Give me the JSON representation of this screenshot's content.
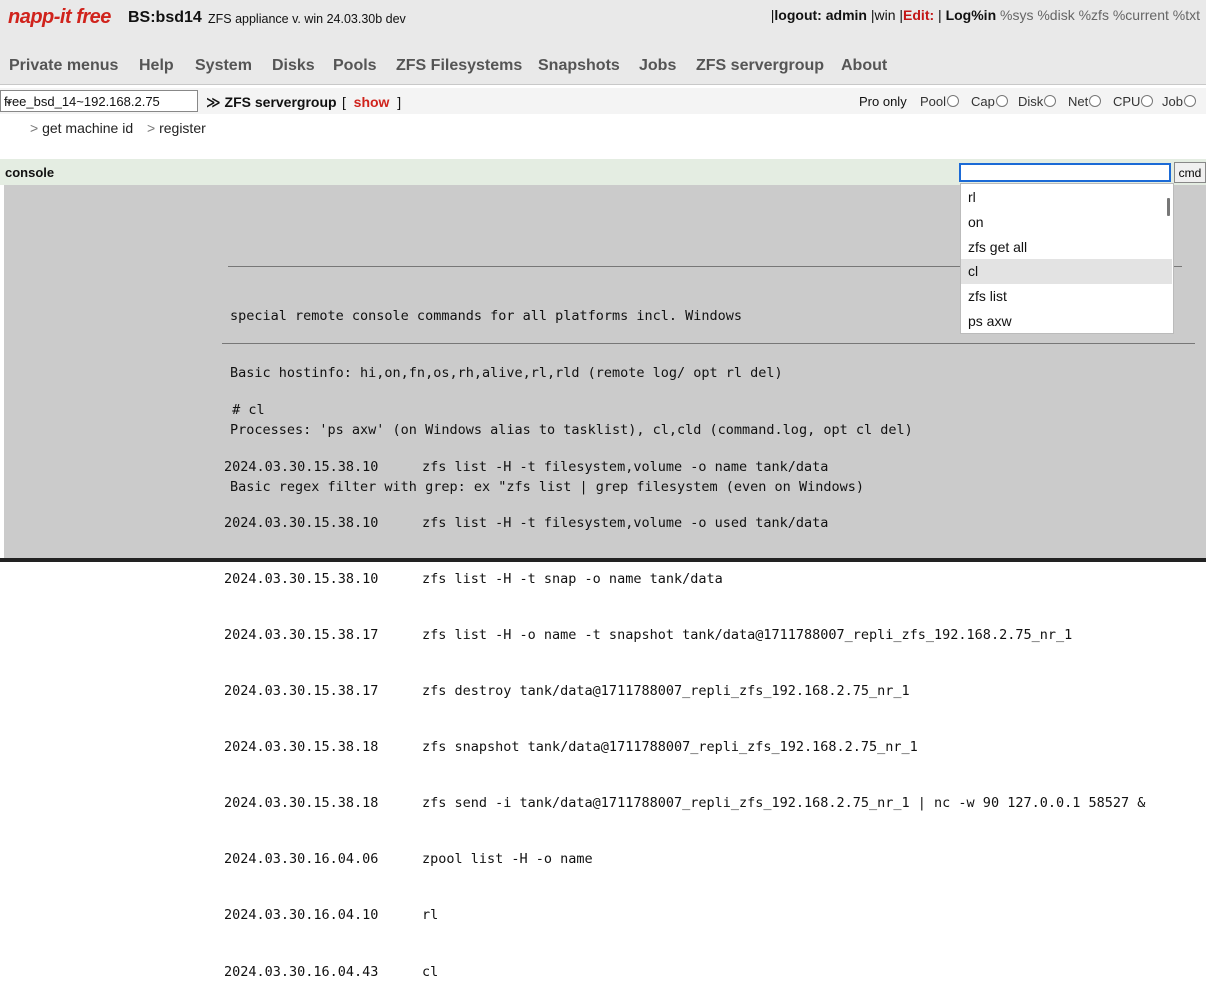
{
  "header": {
    "logo_main": "napp-it",
    "logo_free": "free",
    "host": "BS:bsd14",
    "appliance": "ZFS appliance v. win 24.03.30b dev",
    "sep": "|",
    "logout": "logout: admin",
    "win": "win",
    "edit": "Edit:",
    "log": "Log",
    "pct_in": "%in",
    "pct_sys": "%sys",
    "pct_disk": "%disk",
    "pct_zfs": "%zfs",
    "pct_current": "%current",
    "pct_txt": "%txt"
  },
  "menu": [
    "Private menus",
    "Help",
    "System",
    "Disks",
    "Pools",
    "ZFS Filesystems",
    "Snapshots",
    "Jobs",
    "ZFS servergroup",
    "About"
  ],
  "server_select": {
    "value": "free_bsd_14~192.168.2.75"
  },
  "breadcrumb": {
    "arrow": "≫",
    "title": "ZFS servergroup",
    "open": "[",
    "show": "show",
    "close": "]"
  },
  "monitor": {
    "pro_only": "Pro only",
    "items": [
      "Pool",
      "Cap",
      "Disk",
      "Net",
      "CPU",
      "Job"
    ]
  },
  "submenu": {
    "gt": ">",
    "items": [
      "get machine id",
      "register"
    ]
  },
  "console": {
    "label": "console",
    "input_value": "",
    "cmd_label": "cmd",
    "help_lines": [
      "special remote console commands for all platforms incl. Windows",
      "Basic hostinfo: hi,on,fn,os,rh,alive,rl,rld (remote log/ opt rl del)",
      "Processes: 'ps axw' (on Windows alias to tasklist), cl,cld (command.log, opt cl del)",
      "Basic regex filter with grep: ex \"zfs list | grep filesystem (even on Windows)"
    ],
    "cmd_echo": " # cl",
    "log": [
      {
        "time": "2024.03.30.15.38.10",
        "cmd": "zfs list -H -t filesystem,volume -o name tank/data"
      },
      {
        "time": "2024.03.30.15.38.10",
        "cmd": "zfs list -H -t filesystem,volume -o used tank/data"
      },
      {
        "time": "2024.03.30.15.38.10",
        "cmd": "zfs list -H -t snap -o name tank/data"
      },
      {
        "time": "2024.03.30.15.38.17",
        "cmd": "zfs list -H -o name -t snapshot tank/data@1711788007_repli_zfs_192.168.2.75_nr_1"
      },
      {
        "time": "2024.03.30.15.38.17",
        "cmd": "zfs destroy tank/data@1711788007_repli_zfs_192.168.2.75_nr_1"
      },
      {
        "time": "2024.03.30.15.38.18",
        "cmd": "zfs snapshot tank/data@1711788007_repli_zfs_192.168.2.75_nr_1"
      },
      {
        "time": "2024.03.30.15.38.18",
        "cmd": "zfs send -i tank/data@1711788007_repli_zfs_192.168.2.75_nr_1 | nc -w 90 127.0.0.1 58527 &"
      },
      {
        "time": "2024.03.30.16.04.06",
        "cmd": "zpool list -H -o name"
      },
      {
        "time": "2024.03.30.16.04.10",
        "cmd": "rl"
      },
      {
        "time": "2024.03.30.16.04.43",
        "cmd": "cl"
      }
    ]
  },
  "autocomplete": {
    "items": [
      "rl",
      "on",
      "zfs get all",
      "cl",
      "zfs list",
      "ps axw"
    ],
    "highlighted": "cl"
  }
}
